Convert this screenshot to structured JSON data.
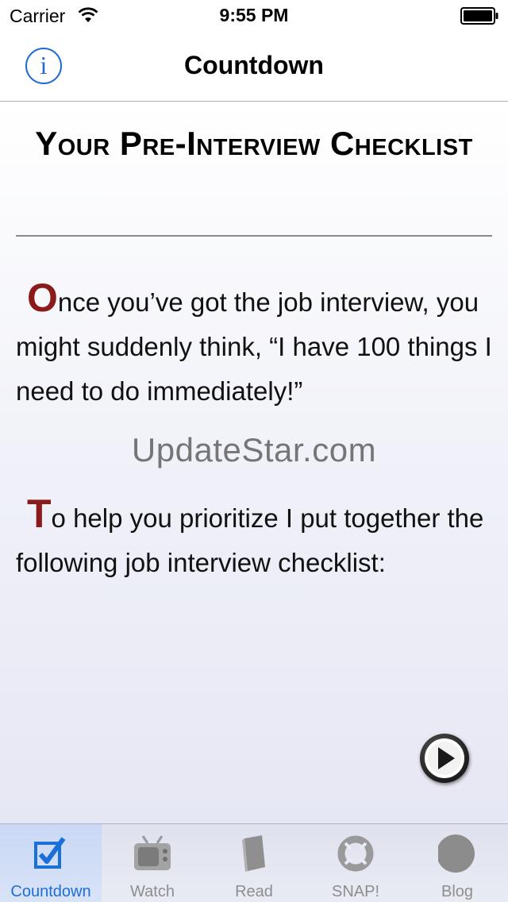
{
  "status_bar": {
    "carrier": "Carrier",
    "time": "9:55 PM",
    "wifi_icon": "wifi-icon",
    "battery_icon": "battery-icon"
  },
  "nav": {
    "title": "Countdown",
    "info_glyph": "i",
    "info_icon": "info-icon"
  },
  "article": {
    "heading": "Your Pre-Interview Checklist",
    "paragraphs": [
      {
        "dropcap": "O",
        "text": "nce you’ve got the job interview, you might suddenly think, “I have 100 things I need to do immediately!”"
      },
      {
        "dropcap": "T",
        "text": "o help you prioritize I put together the following job interview checklist:"
      }
    ],
    "watermark": "UpdateStar.com",
    "play_icon": "play-icon"
  },
  "tab_bar": {
    "tabs": [
      {
        "label": "Countdown",
        "icon": "checkbox-icon",
        "active": true
      },
      {
        "label": "Watch",
        "icon": "tv-icon",
        "active": false
      },
      {
        "label": "Read",
        "icon": "book-icon",
        "active": false
      },
      {
        "label": "SNAP!",
        "icon": "lifebuoy-icon",
        "active": false
      },
      {
        "label": "Blog",
        "icon": "circle-icon",
        "active": false
      }
    ]
  },
  "colors": {
    "accent": "#1b6fd8",
    "dropcap": "#8b1a1a",
    "tab_inactive": "#8e8e8e"
  }
}
